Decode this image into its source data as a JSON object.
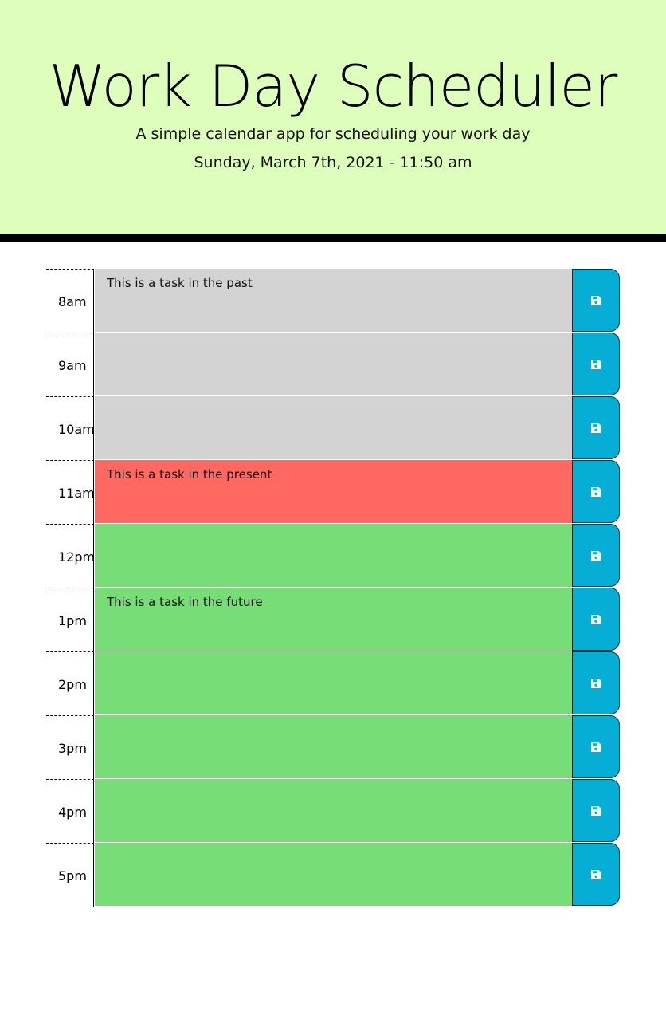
{
  "header": {
    "title": "Work Day Scheduler",
    "subtitle": "A simple calendar app for scheduling your work day",
    "current_day": "Sunday, March 7th, 2021 - 11:50 am"
  },
  "colors": {
    "header_bg": "#ddffbb",
    "past": "#d3d3d3",
    "present": "#ff6961",
    "future": "#77dd77",
    "save_button": "#06aed5"
  },
  "save_icon": "floppy-disk-save-icon",
  "time_blocks": [
    {
      "hour": "8am",
      "task": "This is a task in the past",
      "state": "past"
    },
    {
      "hour": "9am",
      "task": "",
      "state": "past"
    },
    {
      "hour": "10am",
      "task": "",
      "state": "past"
    },
    {
      "hour": "11am",
      "task": "This is a task in the present",
      "state": "present"
    },
    {
      "hour": "12pm",
      "task": "",
      "state": "future"
    },
    {
      "hour": "1pm",
      "task": "This is a task in the future",
      "state": "future"
    },
    {
      "hour": "2pm",
      "task": "",
      "state": "future"
    },
    {
      "hour": "3pm",
      "task": "",
      "state": "future"
    },
    {
      "hour": "4pm",
      "task": "",
      "state": "future"
    },
    {
      "hour": "5pm",
      "task": "",
      "state": "future"
    }
  ]
}
